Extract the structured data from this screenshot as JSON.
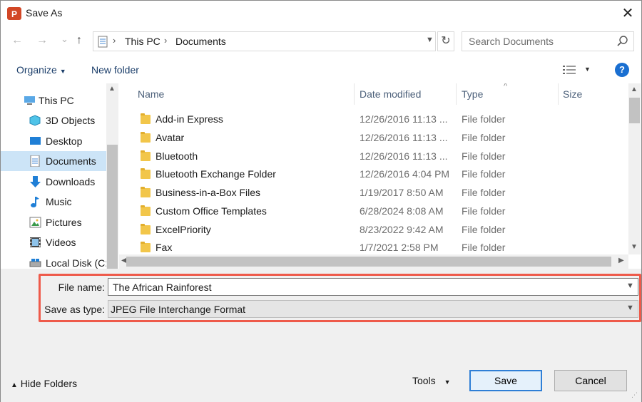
{
  "window": {
    "title": "Save As",
    "close_label": "✕"
  },
  "nav": {
    "back": "←",
    "forward": "→",
    "recent": "⌄",
    "up": "↑",
    "path": [
      "This PC",
      "Documents"
    ],
    "refresh": "↻",
    "search_placeholder": "Search Documents"
  },
  "toolbar": {
    "organize": "Organize",
    "new_folder": "New folder",
    "help": "?"
  },
  "sidebar": {
    "items": [
      {
        "label": "This PC",
        "icon": "computer-icon"
      },
      {
        "label": "3D Objects",
        "icon": "cube-icon"
      },
      {
        "label": "Desktop",
        "icon": "desktop-icon"
      },
      {
        "label": "Documents",
        "icon": "document-icon",
        "selected": true
      },
      {
        "label": "Downloads",
        "icon": "download-arrow-icon"
      },
      {
        "label": "Music",
        "icon": "music-note-icon"
      },
      {
        "label": "Pictures",
        "icon": "picture-icon"
      },
      {
        "label": "Videos",
        "icon": "film-icon"
      },
      {
        "label": "Local Disk (C:",
        "icon": "drive-icon"
      }
    ]
  },
  "file_list": {
    "columns": {
      "name": "Name",
      "date": "Date modified",
      "type": "Type",
      "size": "Size"
    },
    "rows": [
      {
        "name": "Add-in Express",
        "date": "12/26/2016 11:13 ...",
        "type": "File folder"
      },
      {
        "name": "Avatar",
        "date": "12/26/2016 11:13 ...",
        "type": "File folder"
      },
      {
        "name": "Bluetooth",
        "date": "12/26/2016 11:13 ...",
        "type": "File folder"
      },
      {
        "name": "Bluetooth Exchange Folder",
        "date": "12/26/2016 4:04 PM",
        "type": "File folder"
      },
      {
        "name": "Business-in-a-Box Files",
        "date": "1/19/2017 8:50 AM",
        "type": "File folder"
      },
      {
        "name": "Custom Office Templates",
        "date": "6/28/2024 8:08 AM",
        "type": "File folder"
      },
      {
        "name": "ExcelPriority",
        "date": "8/23/2022 9:42 AM",
        "type": "File folder"
      },
      {
        "name": "Fax",
        "date": "1/7/2021 2:58 PM",
        "type": "File folder"
      }
    ]
  },
  "form": {
    "file_name_label": "File name:",
    "file_name_value": "The African Rainforest",
    "save_type_label": "Save as type:",
    "save_type_value": "JPEG File Interchange Format"
  },
  "footer": {
    "hide_folders": "Hide Folders",
    "tools": "Tools",
    "save": "Save",
    "cancel": "Cancel"
  },
  "colors": {
    "accent": "#1a6fd1",
    "highlight": "#ee5a4a",
    "selection": "#cce4f7",
    "folder": "#f2c64a"
  }
}
